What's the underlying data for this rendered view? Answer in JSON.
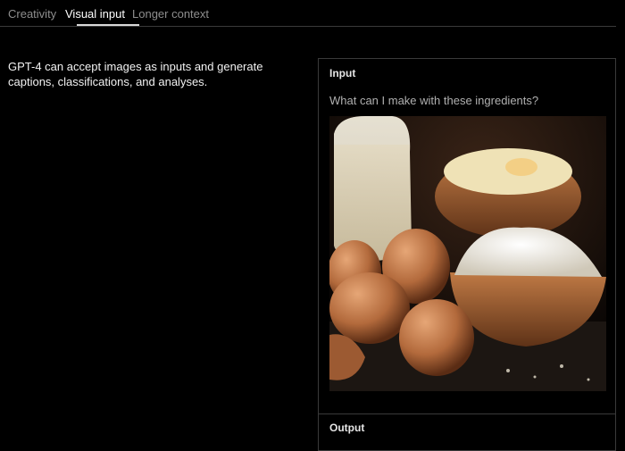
{
  "tabs": [
    {
      "label": "Creativity",
      "active": false
    },
    {
      "label": "Visual input",
      "active": true
    },
    {
      "label": "Longer context",
      "active": false
    }
  ],
  "description": "GPT-4 can accept images as inputs and generate captions, classifications, and analyses.",
  "panel": {
    "input_label": "Input",
    "prompt": "What can I make with these ingredients?",
    "image_subject": "milk pitcher, bowl of eggs and milk, brown eggs, bowl of flour",
    "output_label": "Output"
  },
  "colors": {
    "background": "#000000",
    "border": "#3a3a3a",
    "active_tab": "#ffffff",
    "inactive_tab": "#8e8e8e"
  }
}
